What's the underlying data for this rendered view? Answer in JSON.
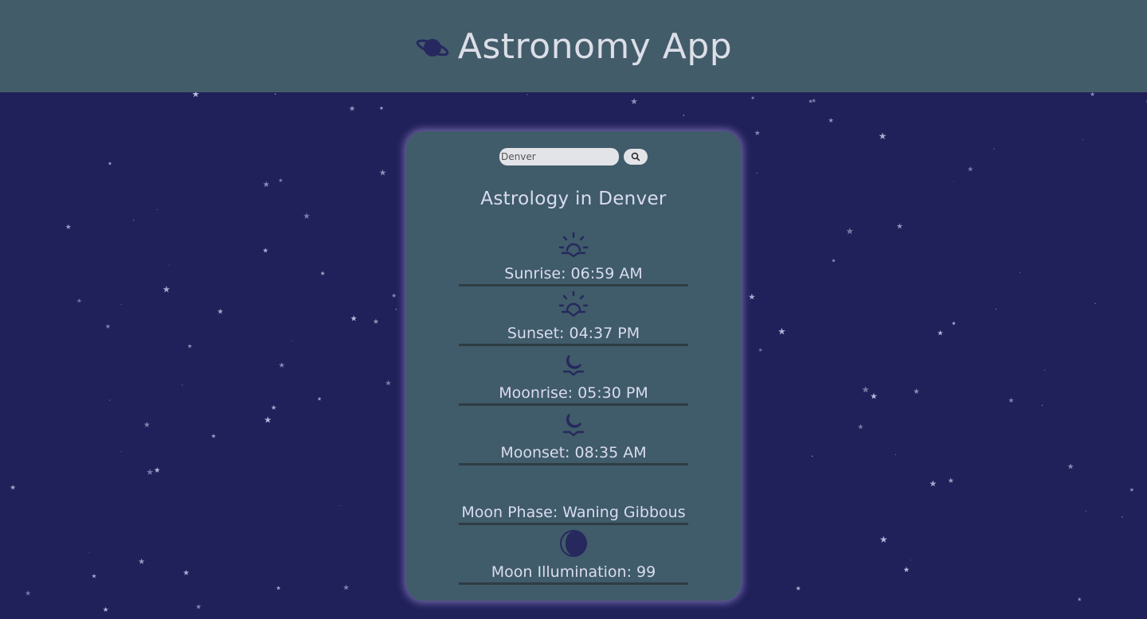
{
  "header": {
    "title": "Astronomy App",
    "icon": "planet-icon"
  },
  "search": {
    "placeholder": "Denver",
    "value": "",
    "button_icon": "search-icon"
  },
  "location_title": "Astrology in Denver",
  "items": [
    {
      "icon": "sunrise-icon",
      "label": "Sunrise: 06:59 AM"
    },
    {
      "icon": "sunset-icon",
      "label": "Sunset: 04:37 PM"
    },
    {
      "icon": "moonrise-icon",
      "label": "Moonrise: 05:30 PM"
    },
    {
      "icon": "moonset-icon",
      "label": "Moonset: 08:35 AM"
    },
    {
      "icon": "crescent-moon-icon",
      "label": "Moon Phase: Waning Gibbous"
    },
    {
      "icon": "moon-illumination-icon",
      "label": "Moon Illumination: 99"
    }
  ],
  "colors": {
    "background": "#20205a",
    "header": "#435c6a",
    "card": "#405b69",
    "icon": "#26285e",
    "text": "#d9dcf0"
  }
}
